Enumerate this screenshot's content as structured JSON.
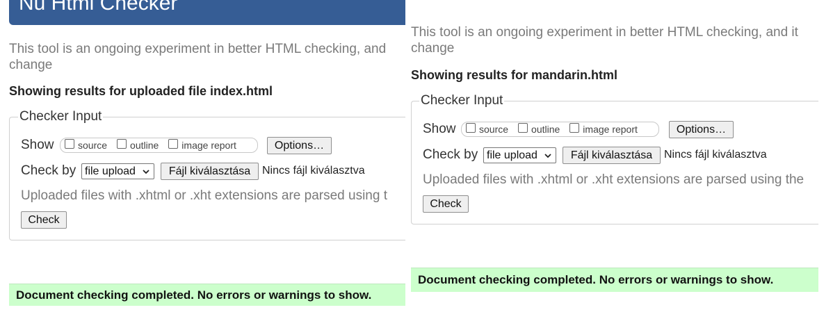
{
  "left": {
    "header_title": "Nu Html Checker",
    "intro_line1": "This tool is an ongoing experiment in better HTML checking, and",
    "intro_line2": "change",
    "results_heading": "Showing results for uploaded file index.html",
    "checker_legend": "Checker Input",
    "show_label": "Show",
    "options": [
      "source",
      "outline",
      "image report"
    ],
    "options_button": "Options…",
    "check_by_label": "Check by",
    "check_by_value": "file upload",
    "file_button": "Fájl kiválasztása",
    "no_file": "Nincs fájl kiválasztva",
    "note": "Uploaded files with .xhtml or .xht extensions are parsed using t",
    "check_button": "Check",
    "success_message": "Document checking completed. No errors or warnings to show."
  },
  "right": {
    "intro_line1": "This tool is an ongoing experiment in better HTML checking, and it",
    "intro_line2": "change",
    "results_heading": "Showing results for mandarin.html",
    "checker_legend": "Checker Input",
    "show_label": "Show",
    "options": [
      "source",
      "outline",
      "image report"
    ],
    "options_button": "Options…",
    "check_by_label": "Check by",
    "check_by_value": "file upload",
    "file_button": "Fájl kiválasztása",
    "no_file": "Nincs fájl kiválasztva",
    "note": "Uploaded files with .xhtml or .xht extensions are parsed using the",
    "check_button": "Check",
    "success_message": "Document checking completed. No errors or warnings to show."
  },
  "colors": {
    "header_bg": "#365d95",
    "success_bg": "#ccffcc",
    "muted_text": "#7a7a7a"
  }
}
